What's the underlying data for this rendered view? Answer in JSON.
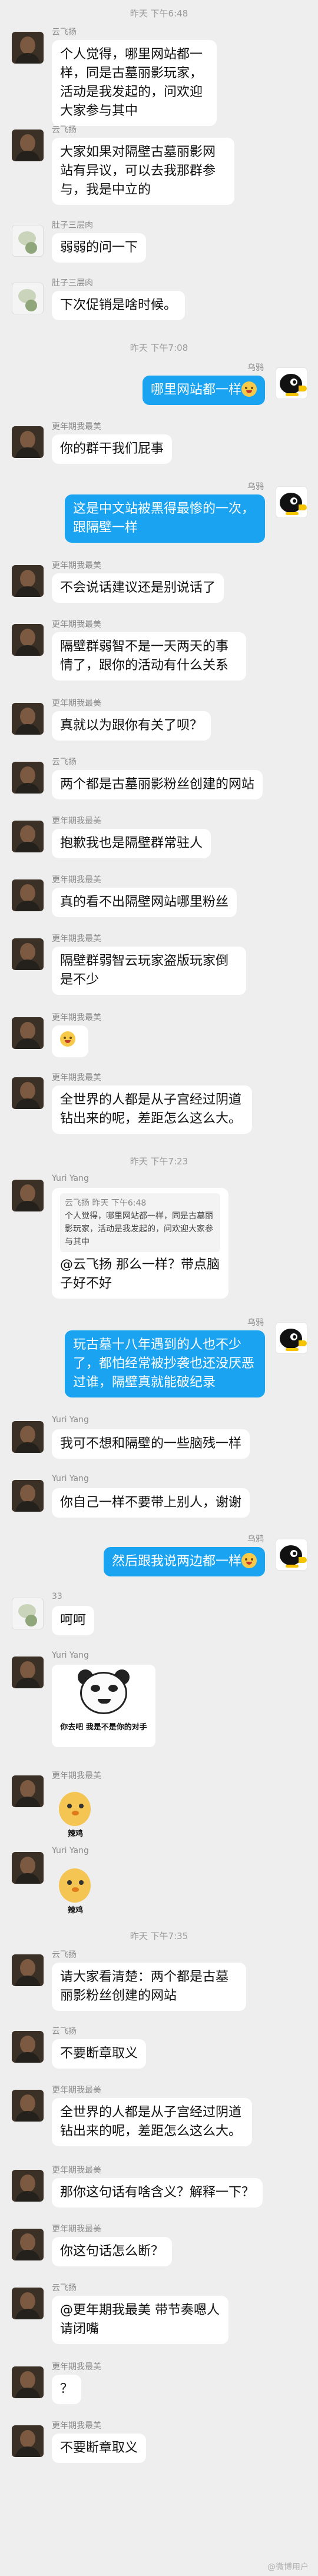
{
  "timestamps": [
    "昨天 下午6:48",
    "昨天 下午7:08",
    "昨天 下午7:23",
    "昨天 下午7:35"
  ],
  "messages": [
    {
      "sender": "云飞扬",
      "text": "个人觉得，哪里网站都一样，同是古墓丽影玩家，活动是我发起的，问欢迎大家参与其中"
    },
    {
      "sender": "云飞扬",
      "text": "大家如果对隔壁古墓丽影网站有异议，可以去我那群参与，我是中立的"
    },
    {
      "sender": "肚子三层肉",
      "text": "弱弱的问一下"
    },
    {
      "sender": "肚子三层肉",
      "text": "下次促销是啥时候。"
    },
    {
      "sender": "乌鸦",
      "text": "哪里网站都一样"
    },
    {
      "sender": "更年期我最美",
      "text": "你的群干我们屁事"
    },
    {
      "sender": "乌鸦",
      "text": "这是中文站被黑得最惨的一次，跟隔壁一样"
    },
    {
      "sender": "更年期我最美",
      "text": "不会说话建议还是别说话了"
    },
    {
      "sender": "更年期我最美",
      "text": "隔壁群弱智不是一天两天的事情了，跟你的活动有什么关系"
    },
    {
      "sender": "更年期我最美",
      "text": "真就以为跟你有关了呗？"
    },
    {
      "sender": "云飞扬",
      "text": "两个都是古墓丽影粉丝创建的网站"
    },
    {
      "sender": "更年期我最美",
      "text": "抱歉我也是隔壁群常驻人"
    },
    {
      "sender": "更年期我最美",
      "text": "真的看不出隔壁网站哪里粉丝"
    },
    {
      "sender": "更年期我最美",
      "text": "隔壁群弱智云玩家盗版玩家倒是不少"
    },
    {
      "sender": "更年期我最美",
      "text": ""
    },
    {
      "sender": "更年期我最美",
      "text": "全世界的人都是从子宫经过阴道钻出来的呢，差距怎么这么大。"
    },
    {
      "sender": "Yuri Yang",
      "quote_header": "云飞扬 昨天 下午6:48",
      "quote_body": "个人觉得，哪里网站都一样，同是古墓丽影玩家，活动是我发起的，问欢迎大家参与其中",
      "text": "@云飞扬 那么一样？带点脑子好不好"
    },
    {
      "sender": "乌鸦",
      "text": "玩古墓十八年遇到的人也不少了，都怕经常被抄袭也还没厌恶过谁，隔壁真就能破纪录"
    },
    {
      "sender": "Yuri Yang",
      "text": "我可不想和隔壁的一些脑残一样"
    },
    {
      "sender": "Yuri Yang",
      "text": "你自己一样不要带上别人，谢谢"
    },
    {
      "sender": "乌鸦",
      "text": "然后跟我说两边都一样"
    },
    {
      "sender": "33",
      "text": "呵呵"
    },
    {
      "sender": "Yuri Yang",
      "sticker_caption": "你去吧 我是不是你的对手"
    },
    {
      "sender": "更年期我最美",
      "sticker_caption": "辣鸡"
    },
    {
      "sender": "Yuri Yang",
      "sticker_caption": "辣鸡"
    },
    {
      "sender": "云飞扬",
      "text": "请大家看清楚：两个都是古墓丽影粉丝创建的网站"
    },
    {
      "sender": "云飞扬",
      "text": "不要断章取义"
    },
    {
      "sender": "更年期我最美",
      "text": "全世界的人都是从子宫经过阴道钻出来的呢，差距怎么这么大。"
    },
    {
      "sender": "更年期我最美",
      "text": "那你这句话有啥含义？解释一下？"
    },
    {
      "sender": "更年期我最美",
      "text": "你这句话怎么断？"
    },
    {
      "sender": "云飞扬",
      "text": "@更年期我最美 带节奏嗯人请闭嘴"
    },
    {
      "sender": "更年期我最美",
      "text": "？"
    },
    {
      "sender": "更年期我最美",
      "text": "不要断章取义"
    }
  ],
  "watermark": "@微博用户"
}
